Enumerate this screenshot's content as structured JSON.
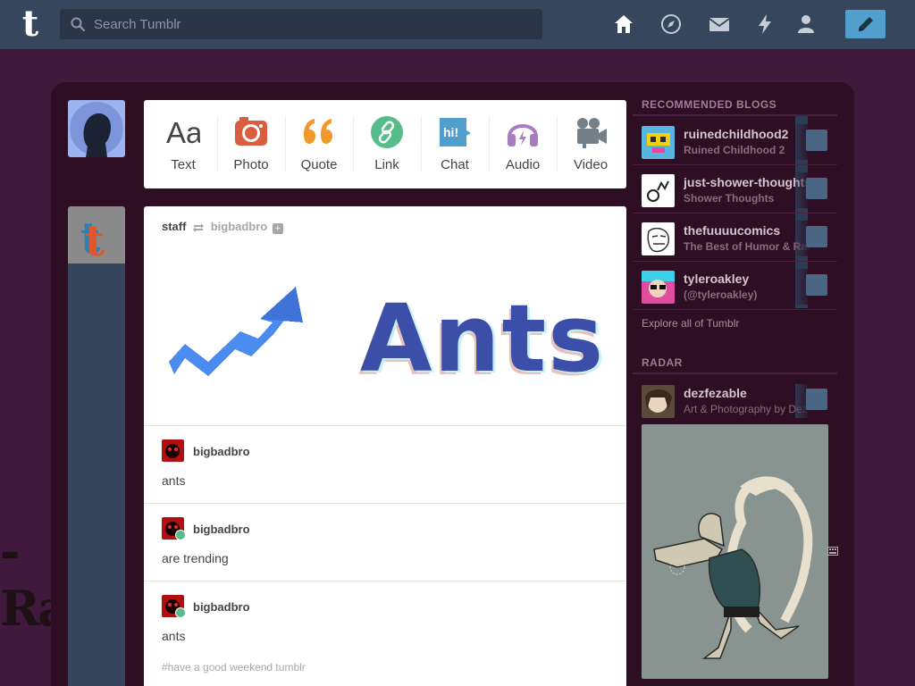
{
  "topbar": {
    "search_placeholder": "Search Tumblr",
    "logo": "t",
    "nav_icons": [
      "home-icon",
      "explore-icon",
      "messages-icon",
      "activity-icon",
      "account-icon"
    ],
    "compose_icon": "pencil-icon"
  },
  "background_art_text": "-Ray-",
  "post_types": [
    {
      "label": "Text",
      "icon": "text-icon",
      "glyph": "Aa",
      "color": "#444444"
    },
    {
      "label": "Photo",
      "icon": "camera-icon",
      "color": "#d95e40"
    },
    {
      "label": "Quote",
      "icon": "quote-icon",
      "glyph": "66",
      "color": "#f2992e"
    },
    {
      "label": "Link",
      "icon": "link-icon",
      "color": "#56bc8a"
    },
    {
      "label": "Chat",
      "icon": "chat-icon",
      "glyph": "hi!",
      "color": "#529ecc"
    },
    {
      "label": "Audio",
      "icon": "headphones-icon",
      "color": "#a77dc2"
    },
    {
      "label": "Video",
      "icon": "video-camera-icon",
      "color": "#748089"
    }
  ],
  "post": {
    "author": "staff",
    "reblogged_from": "bigbadbro",
    "hero_text": "Ants",
    "reblogs": [
      {
        "user": "bigbadbro",
        "text": "ants"
      },
      {
        "user": "bigbadbro",
        "text": "are trending"
      },
      {
        "user": "bigbadbro",
        "text": "ants"
      }
    ],
    "tags": "#have a good weekend tumblr"
  },
  "sidebar": {
    "recommended_title": "RECOMMENDED BLOGS",
    "recommended": [
      {
        "name": "ruinedchildhood2",
        "subtitle": "Ruined Childhood 2"
      },
      {
        "name": "just-shower-thoughts",
        "subtitle": "Shower Thoughts"
      },
      {
        "name": "thefuuuucomics",
        "subtitle": "The Best of Humor & Rage"
      },
      {
        "name": "tyleroakley",
        "subtitle": "(@tyleroakley)"
      }
    ],
    "explore_link": "Explore all of Tumblr",
    "radar_title": "RADAR",
    "radar": {
      "name": "dezfezable",
      "subtitle": "Art & Photography by Dez"
    }
  },
  "colors": {
    "topbar": "#36465d",
    "page_bg": "#3f1a3d",
    "panel_bg": "#2e0e23",
    "accent": "#529ecc"
  }
}
